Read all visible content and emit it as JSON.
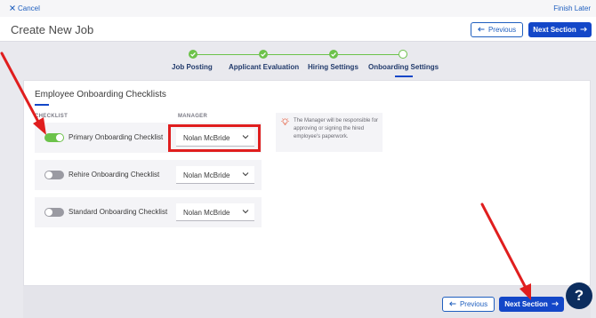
{
  "topbar": {
    "cancel_label": "Cancel",
    "finish_label": "Finish Later"
  },
  "header": {
    "title": "Create New Job",
    "previous_label": "Previous",
    "next_label": "Next Section"
  },
  "stepper": {
    "steps": [
      {
        "label": "Job Posting",
        "state": "complete"
      },
      {
        "label": "Applicant Evaluation",
        "state": "complete"
      },
      {
        "label": "Hiring Settings",
        "state": "complete"
      },
      {
        "label": "Onboarding Settings",
        "state": "current"
      }
    ]
  },
  "section": {
    "title": "Employee Onboarding Checklists",
    "col_checklist": "CHECKLIST",
    "col_manager": "MANAGER",
    "rows": [
      {
        "label": "Primary Onboarding Checklist",
        "enabled": true,
        "manager": "Nolan McBride"
      },
      {
        "label": "Rehire Onboarding Checklist",
        "enabled": false,
        "manager": "Nolan McBride"
      },
      {
        "label": "Standard Onboarding Checklist",
        "enabled": false,
        "manager": "Nolan McBride"
      }
    ],
    "note": "The Manager will be responsible for approving or signing the hired employee's paperwork."
  },
  "footer": {
    "previous_label": "Previous",
    "next_label": "Next Section"
  },
  "help": {
    "label": "?"
  },
  "colors": {
    "primary": "#1347c8",
    "success": "#6cc24a",
    "annotation": "#e01e1e",
    "help": "#0c2d5e"
  },
  "icons": {
    "cancel": "close-icon",
    "previous": "arrow-left-icon",
    "next": "arrow-right-icon",
    "select": "chevron-down-icon",
    "note": "lightbulb-icon",
    "step_done": "check-icon"
  }
}
